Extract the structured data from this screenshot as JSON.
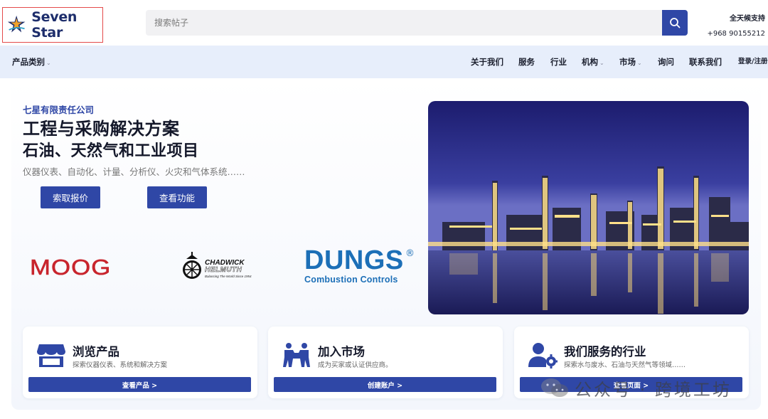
{
  "header": {
    "logo_text": "Seven Star",
    "logo_sub": "Star",
    "search_placeholder": "搜索帖子",
    "support_label": "全天候支持",
    "support_phone": "+968 90155212"
  },
  "nav": {
    "categories": "产品类别",
    "items": [
      "关于我们",
      "服务",
      "行业",
      "机构",
      "市场",
      "询问",
      "联系我们",
      "登录/注册"
    ]
  },
  "hero": {
    "company": "七星有限责任公司",
    "title_line1": "工程与采购解决方案",
    "title_line2": "石油、天然气和工业项目",
    "description": "仪器仪表、自动化、计量、分析仪、火灾和气体系统……",
    "btn_quote": "索取报价",
    "btn_features": "查看功能"
  },
  "brands": {
    "moog": "MOOG",
    "chadwick_line1": "CHADWICK",
    "chadwick_line2": "HELMUTH",
    "chadwick_tagline": "Balancing The World Since 1954",
    "dungs_name": "DUNGS",
    "dungs_reg": "®",
    "dungs_sub": "Combustion Controls"
  },
  "cards": [
    {
      "title": "浏览产品",
      "desc": "探索仪器仪表、系统和解决方案",
      "button": "查看产品 >",
      "icon": "store-icon"
    },
    {
      "title": "加入市场",
      "desc": "成为买家或认证供应商。",
      "button": "创建账户 >",
      "icon": "handshake-people-icon"
    },
    {
      "title": "我们服务的行业",
      "desc": "探索水与废水、石油与天然气等领域……",
      "button": "查看页面 >",
      "icon": "user-gear-icon"
    }
  ],
  "watermark": {
    "text": "公众号 · 跨境工坊",
    "icon": "wechat-icon"
  },
  "colors": {
    "primary": "#2f47a6",
    "nav_bg": "#e7eefb",
    "moog": "#c8252d",
    "dungs": "#1c6fb7"
  }
}
